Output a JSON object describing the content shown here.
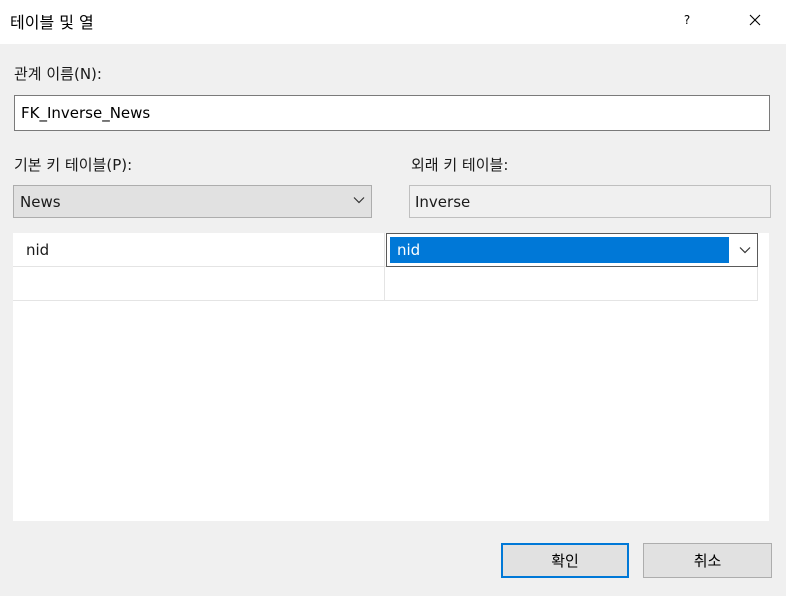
{
  "window": {
    "title": "테이블 및 열",
    "help_label": "?"
  },
  "relationship_name": {
    "label": "관계 이름(N):",
    "value": "FK_Inverse_News"
  },
  "primary_key_table": {
    "label": "기본 키 테이블(P):",
    "selected": "News"
  },
  "foreign_key_table": {
    "label": "외래 키 테이블:",
    "value": "Inverse"
  },
  "columns_grid": {
    "rows": [
      {
        "primary": "nid",
        "foreign": "nid"
      },
      {
        "primary": "",
        "foreign": ""
      }
    ]
  },
  "buttons": {
    "ok_label": "확인",
    "cancel_label": "취소"
  },
  "colors": {
    "accent": "#0078d7",
    "dialog_bg": "#f0f0f0",
    "button_bg": "#e1e1e1"
  }
}
